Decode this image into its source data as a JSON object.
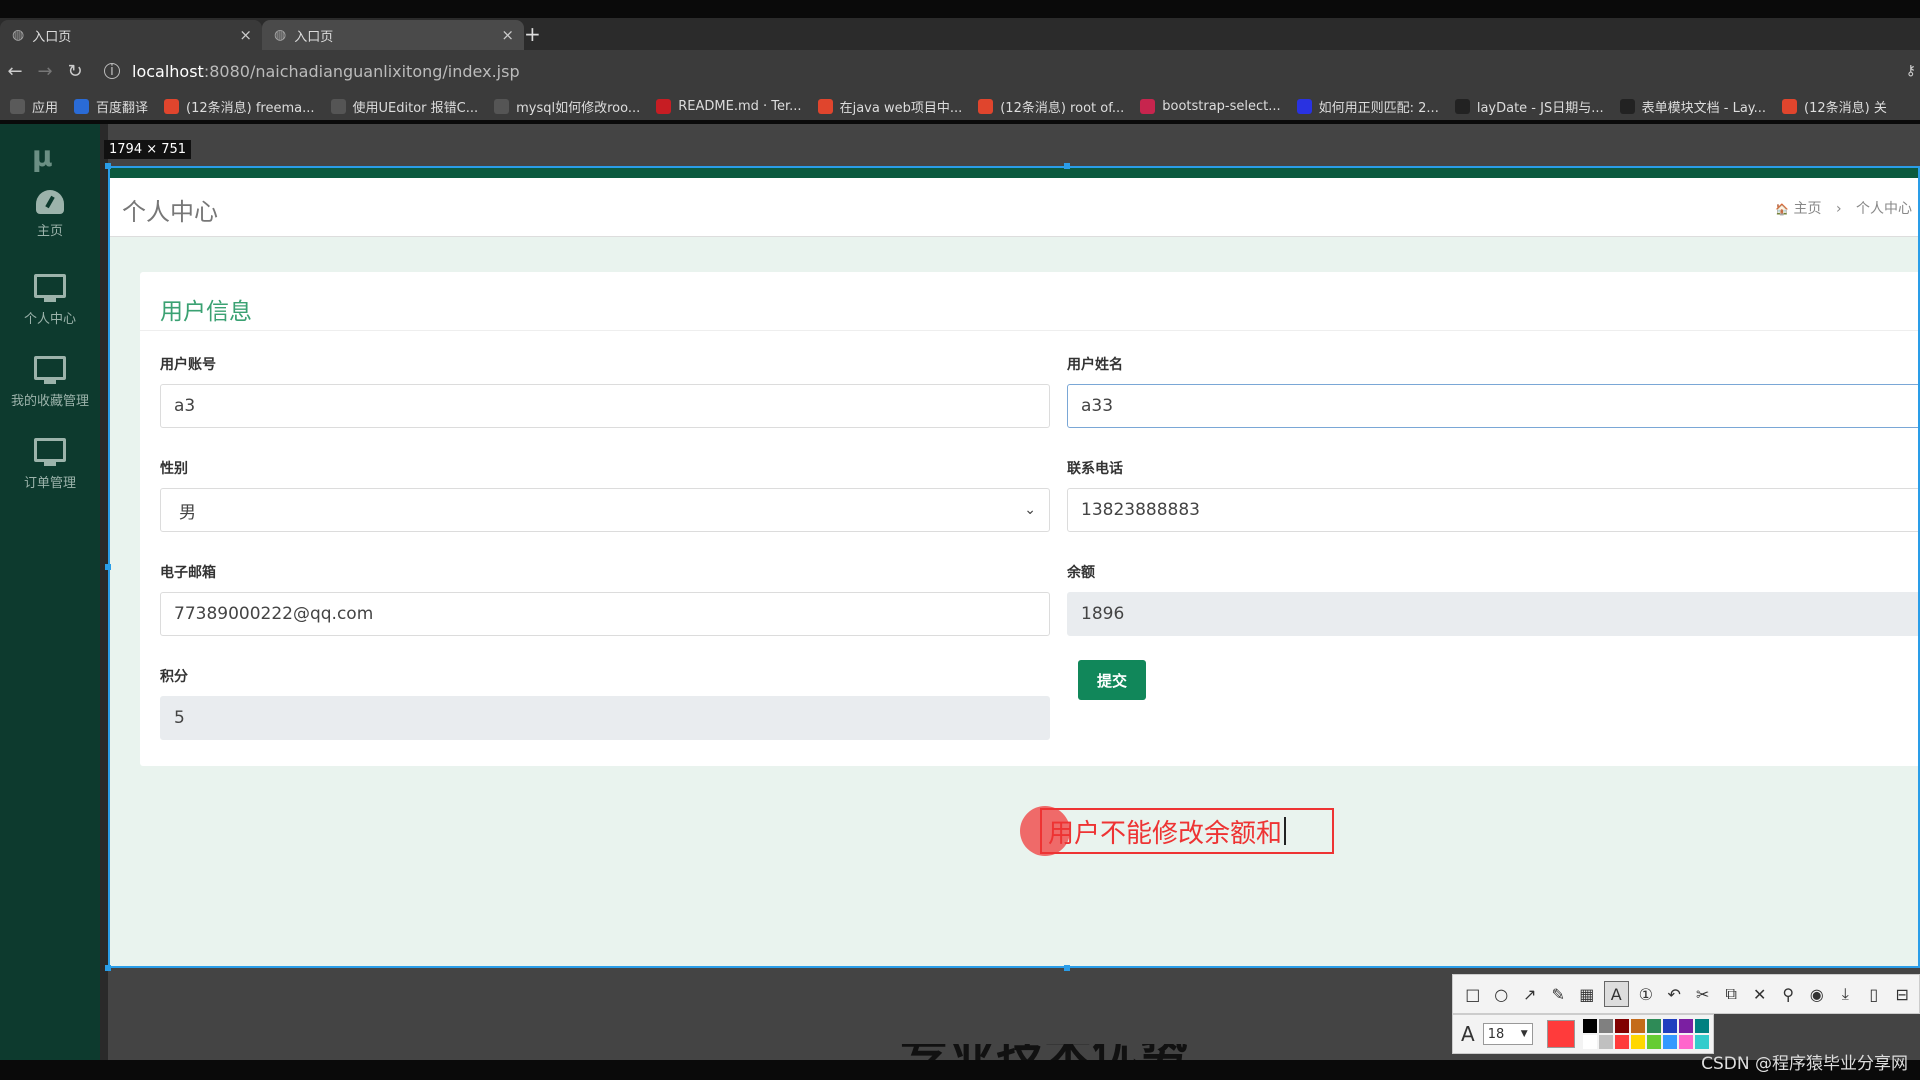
{
  "browser": {
    "tabs": [
      {
        "title": "入口页",
        "active": false
      },
      {
        "title": "入口页",
        "active": true
      }
    ],
    "url_host": "localhost",
    "url_path": ":8080/naichadianguanlixitong/index.jsp",
    "bookmarks": [
      {
        "label": "应用",
        "icon": "apps-icon",
        "color": "#5a5a5a"
      },
      {
        "label": "百度翻译",
        "icon": "baidu-translate-icon",
        "color": "#2a6bd6"
      },
      {
        "label": "(12条消息) freema...",
        "icon": "csdn-icon",
        "color": "#e0452d"
      },
      {
        "label": "使用UEditor 报错C...",
        "icon": "link-icon",
        "color": "#555"
      },
      {
        "label": "mysql如何修改roo...",
        "icon": "link-icon",
        "color": "#555"
      },
      {
        "label": "README.md · Ter...",
        "icon": "gitee-icon",
        "color": "#c71d23"
      },
      {
        "label": "在java web项目中...",
        "icon": "csdn-icon",
        "color": "#e0452d"
      },
      {
        "label": "(12条消息) root of...",
        "icon": "csdn-icon",
        "color": "#e0452d"
      },
      {
        "label": "bootstrap-select...",
        "icon": "bootstrap-icon",
        "color": "#c7254e"
      },
      {
        "label": "如何用正则匹配: 2...",
        "icon": "baidu-icon",
        "color": "#2932e1"
      },
      {
        "label": "layDate - JS日期与...",
        "icon": "layui-icon",
        "color": "#222"
      },
      {
        "label": "表单模块文档 - Lay...",
        "icon": "layui-icon",
        "color": "#222"
      },
      {
        "label": "(12条消息) 关",
        "icon": "csdn-icon",
        "color": "#e0452d"
      }
    ]
  },
  "sidebar": {
    "logo": "μ",
    "items": [
      {
        "label": "主页",
        "icon": "dashboard-icon"
      },
      {
        "label": "个人中心",
        "icon": "monitor-icon"
      },
      {
        "label": "我的收藏管理",
        "icon": "monitor-icon"
      },
      {
        "label": "订单管理",
        "icon": "monitor-icon"
      }
    ]
  },
  "header": {
    "title": "个人中心",
    "breadcrumb_home": "主页",
    "breadcrumb_current": "个人中心",
    "breadcrumb_sep": "›",
    "home_icon": "🏠"
  },
  "card": {
    "title": "用户信息",
    "fields": {
      "account": {
        "label": "用户账号",
        "value": "a3"
      },
      "name": {
        "label": "用户姓名",
        "value": "a33"
      },
      "gender": {
        "label": "性别",
        "value": "男"
      },
      "phone": {
        "label": "联系电话",
        "value": "13823888883"
      },
      "email": {
        "label": "电子邮箱",
        "value": "77389000222@qq.com"
      },
      "balance": {
        "label": "余额",
        "value": "1896"
      },
      "points": {
        "label": "积分",
        "value": "5"
      }
    },
    "submit_label": "提交"
  },
  "annotation": {
    "text": "用户不能修改余额和"
  },
  "overlay": {
    "size_label": "1794 × 751",
    "selection_color": "#2a9de8"
  },
  "toolbar": {
    "font_size": "18",
    "font_icon": "A",
    "tools": [
      "rect-icon",
      "ellipse-icon",
      "arrow-icon",
      "pen-icon",
      "mosaic-icon",
      "text-icon",
      "number-icon",
      "undo-icon",
      "cut-icon",
      "pin-icon",
      "cross-icon",
      "pin2-icon",
      "record-icon",
      "download-icon",
      "copy-icon",
      "save-icon"
    ],
    "current_color": "#ff3b3b",
    "palette": [
      "#000000",
      "#808080",
      "#800000",
      "#c46b1a",
      "#2e8b57",
      "#1f3fbf",
      "#7b1fa2",
      "#008080",
      "#ffffff",
      "#c0c0c0",
      "#ff3b3b",
      "#ffd700",
      "#66cc33",
      "#3399ff",
      "#ff66cc",
      "#33cccc"
    ]
  },
  "bottom_text": "专业技术优势",
  "watermark": "CSDN @程序猿毕业分享网"
}
